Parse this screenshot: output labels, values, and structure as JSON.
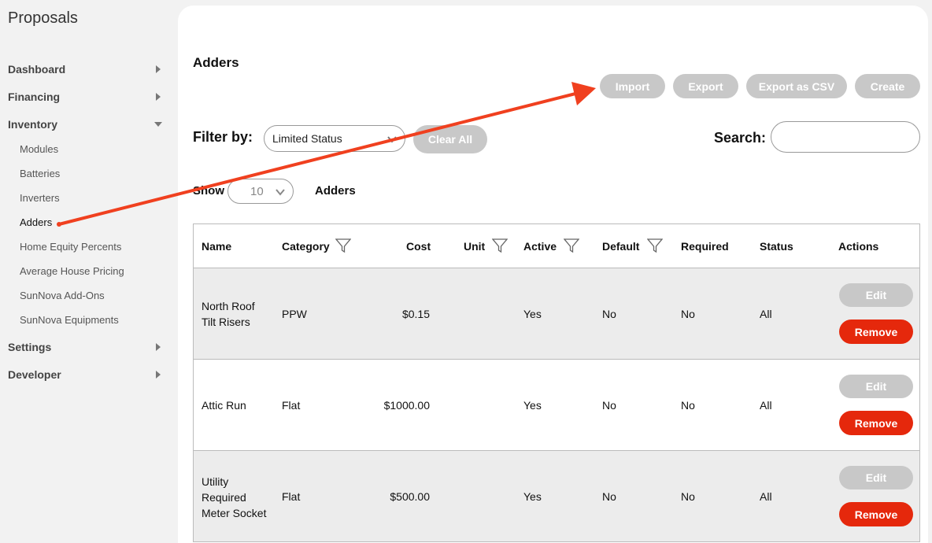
{
  "app_title": "Proposals",
  "sidebar": {
    "items": [
      {
        "label": "Dashboard"
      },
      {
        "label": "Financing"
      },
      {
        "label": "Inventory"
      },
      {
        "label": "Settings"
      },
      {
        "label": "Developer"
      }
    ],
    "inventory_sub": [
      {
        "label": "Modules"
      },
      {
        "label": "Batteries"
      },
      {
        "label": "Inverters"
      },
      {
        "label": "Adders"
      },
      {
        "label": "Home Equity Percents"
      },
      {
        "label": "Average House Pricing"
      },
      {
        "label": "SunNova Add-Ons"
      },
      {
        "label": "SunNova Equipments"
      }
    ]
  },
  "main": {
    "title": "Adders",
    "buttons": {
      "import": "Import",
      "export": "Export",
      "export_csv": "Export as CSV",
      "create": "Create",
      "clear_all": "Clear All"
    },
    "filter_label": "Filter by:",
    "filter_value": "Limited Status",
    "search_label": "Search:",
    "search_value": "",
    "show_label": "Show",
    "show_value": "10",
    "show_suffix": "Adders"
  },
  "table": {
    "headers": [
      "Name",
      "Category",
      "Cost",
      "Unit",
      "Active",
      "Default",
      "Required",
      "Status",
      "Actions"
    ],
    "rows": [
      {
        "name_lines": [
          "North Roof",
          "Tilt Risers"
        ],
        "category": "PPW",
        "cost": "$0.15",
        "unit": "",
        "active": "Yes",
        "default": "No",
        "required": "No",
        "status": "All"
      },
      {
        "name_lines": [
          "Attic Run"
        ],
        "category": "Flat",
        "cost": "$1000.00",
        "unit": "",
        "active": "Yes",
        "default": "No",
        "required": "No",
        "status": "All"
      },
      {
        "name_lines": [
          "Utility",
          "Required",
          "Meter Socket"
        ],
        "category": "Flat",
        "cost": "$500.00",
        "unit": "",
        "active": "Yes",
        "default": "No",
        "required": "No",
        "status": "All"
      }
    ],
    "edit_label": "Edit",
    "remove_label": "Remove"
  },
  "colors": {
    "remove": "#e5280c",
    "gray_button": "#c8c8c8",
    "annotation_arrow": "#f0401f"
  }
}
